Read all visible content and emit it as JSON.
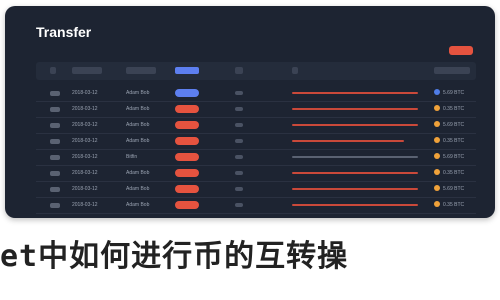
{
  "window": {
    "title": "Transfer"
  },
  "toolbar": {
    "action_label": ""
  },
  "colors": {
    "panel_bg": "#1d2432",
    "accent": "#e5533f",
    "pill_blue": "#5d7ff0",
    "bar_red": "#c9493a",
    "bar_grey": "#5a6272",
    "chip_orange": "#f0a23a",
    "chip_blue": "#4f7de8"
  },
  "table": {
    "rows": [
      {
        "time": "2018-03-12",
        "name": "Adam Bob",
        "status_color": "#5d7ff0",
        "bar_color": "#c9493a",
        "bar_fraction": 0.93,
        "chip_color": "#4f7de8",
        "amount": "5.69 BTC"
      },
      {
        "time": "2018-03-12",
        "name": "Adam Bob",
        "status_color": "#e5533f",
        "bar_color": "#c9493a",
        "bar_fraction": 0.93,
        "chip_color": "#f0a23a",
        "amount": "0.35 BTC"
      },
      {
        "time": "2018-03-12",
        "name": "Adam Bob",
        "status_color": "#e5533f",
        "bar_color": "#c9493a",
        "bar_fraction": 0.93,
        "chip_color": "#f0a23a",
        "amount": "5.69 BTC"
      },
      {
        "time": "2018-03-12",
        "name": "Adam Bob",
        "status_color": "#e5533f",
        "bar_color": "#c9493a",
        "bar_fraction": 0.82,
        "chip_color": "#f0a23a",
        "amount": "0.35 BTC"
      },
      {
        "time": "2018-03-12",
        "name": "Bitfin",
        "status_color": "#e5533f",
        "bar_color": "#5a6272",
        "bar_fraction": 0.93,
        "chip_color": "#f0a23a",
        "amount": "5.69 BTC"
      },
      {
        "time": "2018-03-12",
        "name": "Adam Bob",
        "status_color": "#e5533f",
        "bar_color": "#c9493a",
        "bar_fraction": 0.93,
        "chip_color": "#f0a23a",
        "amount": "0.35 BTC"
      },
      {
        "time": "2018-03-12",
        "name": "Adam Bob",
        "status_color": "#e5533f",
        "bar_color": "#c9493a",
        "bar_fraction": 0.93,
        "chip_color": "#f0a23a",
        "amount": "5.69 BTC"
      },
      {
        "time": "2018-03-12",
        "name": "Adam Bob",
        "status_color": "#e5533f",
        "bar_color": "#c9493a",
        "bar_fraction": 0.93,
        "chip_color": "#f0a23a",
        "amount": "0.35 BTC"
      }
    ]
  },
  "caption": {
    "text": "et中如何进行币的互转操"
  }
}
